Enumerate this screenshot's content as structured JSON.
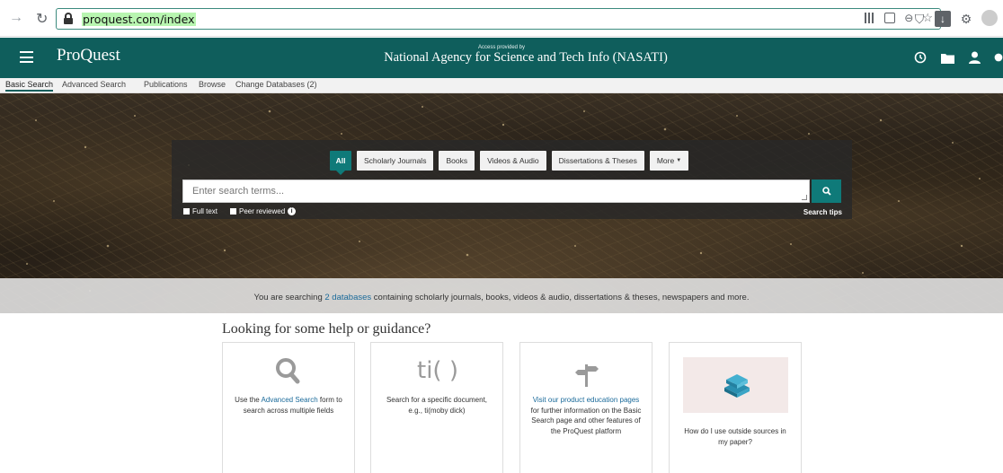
{
  "browser": {
    "url": "proquest.com/index"
  },
  "header": {
    "logo": "ProQuest",
    "access_small": "Access provided by",
    "access_name": "National Agency for Science and Tech Info (NASATI)"
  },
  "subnav": {
    "items": [
      "Basic Search",
      "Advanced Search",
      "Publications",
      "Browse",
      "Change Databases (2)"
    ]
  },
  "search": {
    "tabs": [
      "All",
      "Scholarly Journals",
      "Books",
      "Videos & Audio",
      "Dissertations & Theses",
      "More"
    ],
    "placeholder": "Enter search terms...",
    "full_text_label": "Full text",
    "peer_reviewed_label": "Peer reviewed",
    "search_tips": "Search tips"
  },
  "databases": {
    "prefix": "You are searching ",
    "link": "2 databases",
    "suffix": " containing scholarly journals, books, videos & audio, dissertations & theses, newspapers and more."
  },
  "help": {
    "title": "Looking for some help or guidance?",
    "card1": {
      "pre": "Use the ",
      "link": "Advanced Search",
      "post": " form to search across multiple fields"
    },
    "card2": {
      "glyph": "ti( )",
      "text": "Search for a specific document, e.g., ti(moby dick)"
    },
    "card3": {
      "link": "Visit our product education pages",
      "post": " for further information on the Basic Search page and other features of the ProQuest platform"
    },
    "card4": {
      "text": "How do I use outside sources in my paper?"
    }
  },
  "colors": {
    "brand": "#0f5e5c",
    "accent": "#0f7a79",
    "link": "#1a6a9a"
  }
}
